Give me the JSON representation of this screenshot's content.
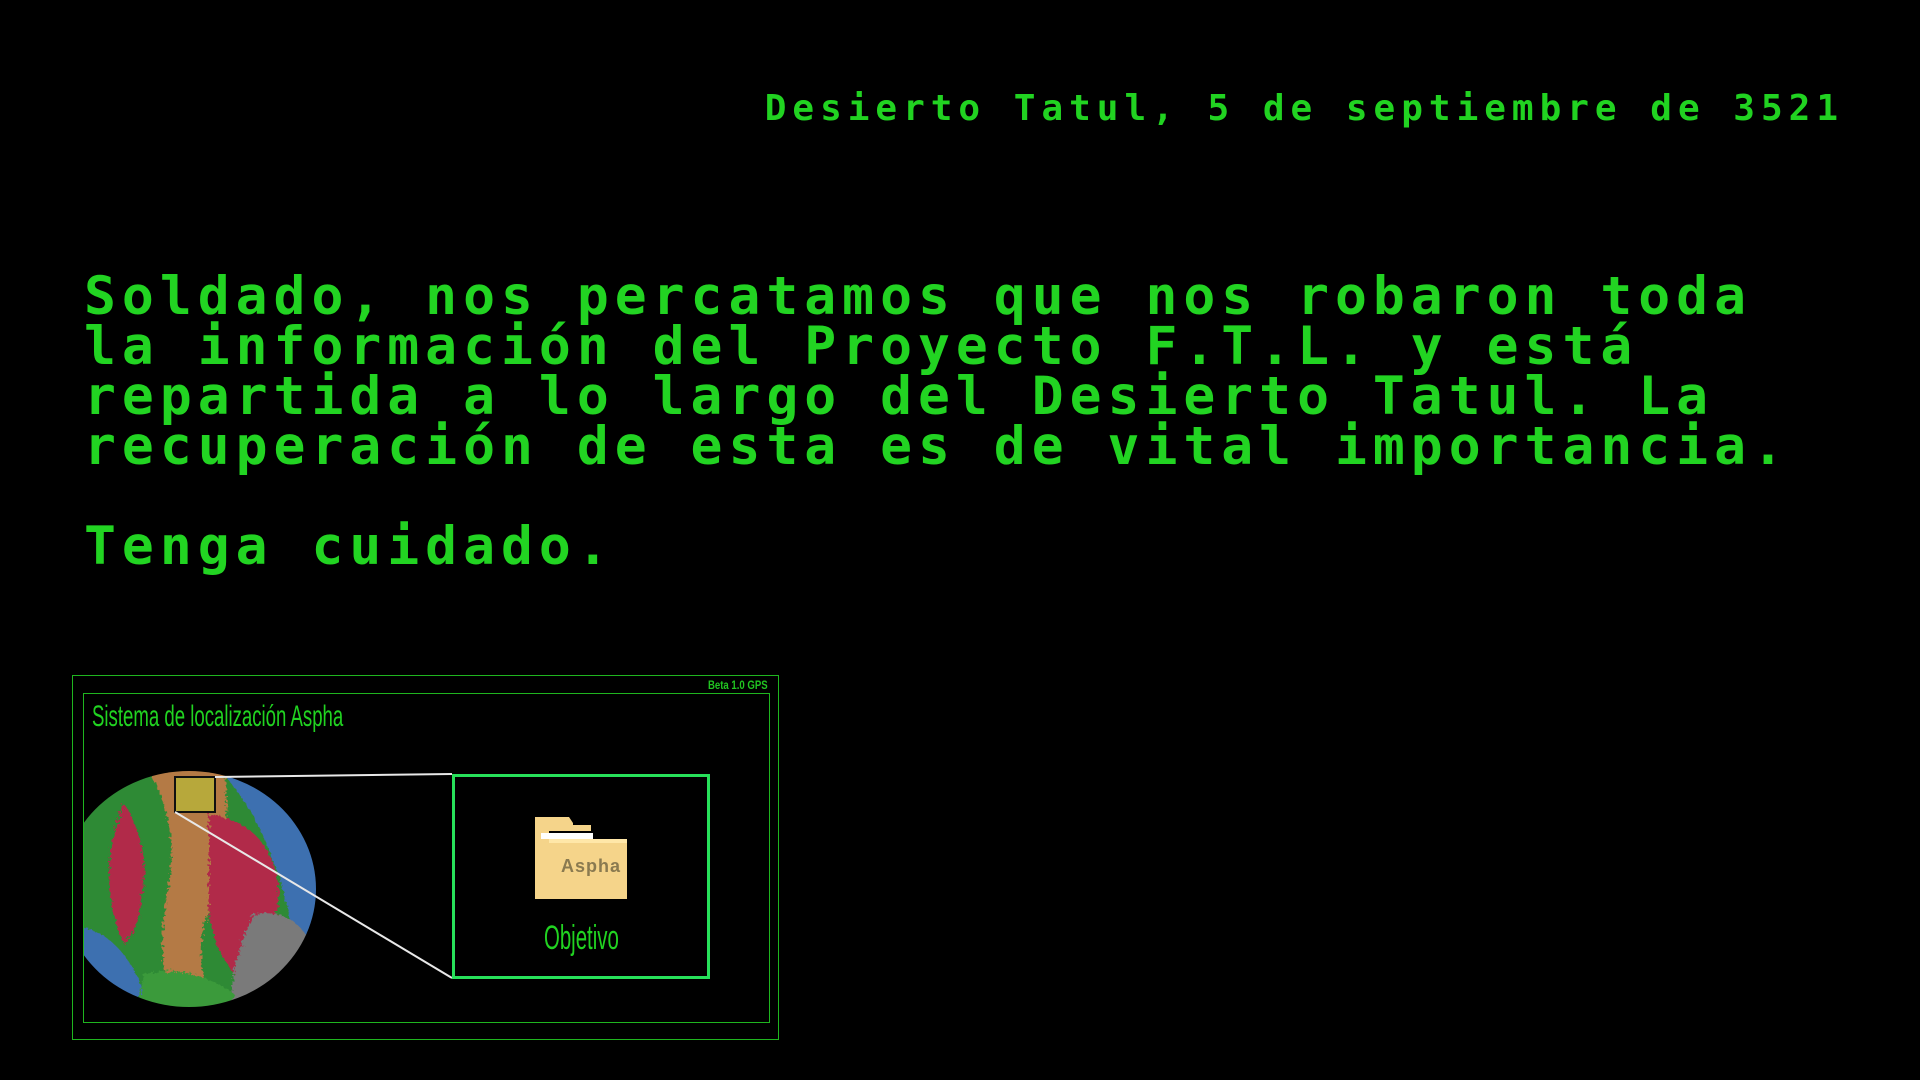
{
  "header": {
    "date_line": "Desierto Tatul, 5 de septiembre de 3521"
  },
  "briefing": {
    "message": "Soldado, nos percatamos que nos robaron toda la información del Proyecto F.T.L. y está repartida a lo largo del Desierto Tatul. La recuperación de esta es de vital importancia.",
    "warning": "Tenga cuidado."
  },
  "gps": {
    "version_label": "Beta 1.0 GPS",
    "title": "Sistema de localización Aspha",
    "target": {
      "folder_label": "Aspha",
      "label": "Objetivo",
      "icon": "folder-icon"
    },
    "planet_icon": "planet-icon"
  },
  "colors": {
    "background": "#000000",
    "text_green": "#21d321",
    "frame_green": "#1fb51f",
    "target_frame": "#27e05a",
    "folder": "#f5d48a"
  }
}
